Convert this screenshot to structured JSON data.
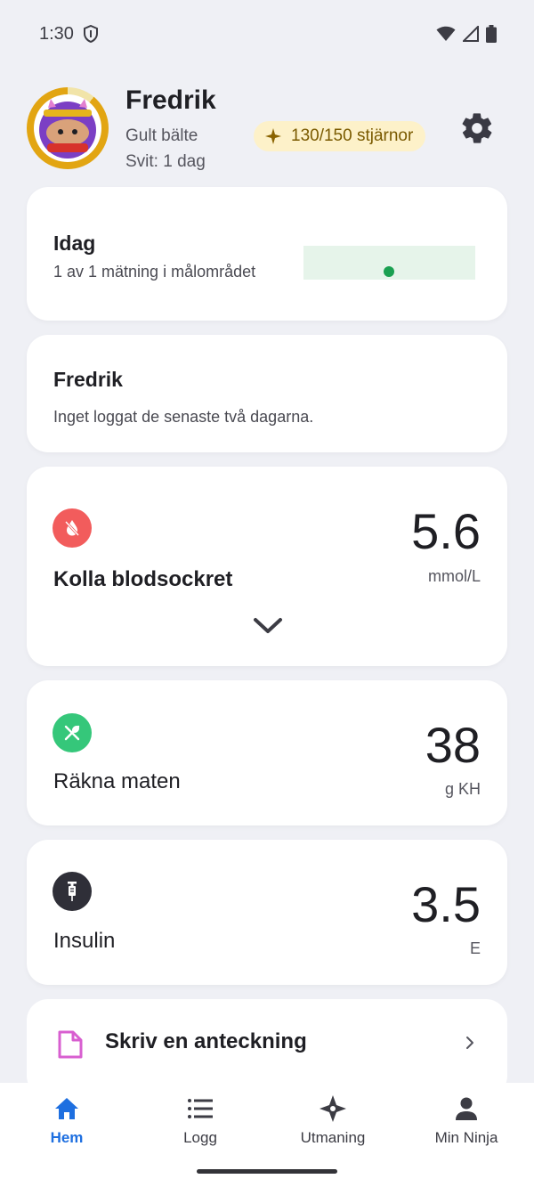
{
  "status_bar": {
    "time": "1:30"
  },
  "profile": {
    "name": "Fredrik",
    "belt": "Gult bälte",
    "streak": "Svit: 1 dag",
    "stars": "130/150 stjärnor"
  },
  "today_card": {
    "title": "Idag",
    "subtitle": "1 av 1 mätning i målområdet"
  },
  "log_card": {
    "title": "Fredrik",
    "message": "Inget loggat de senaste två dagarna."
  },
  "blood_sugar": {
    "label": "Kolla blodsockret",
    "value": "5.6",
    "unit": "mmol/L",
    "color": "#f25c5c"
  },
  "food": {
    "label": "Räkna maten",
    "value": "38",
    "unit": "g KH",
    "color": "#35c77a"
  },
  "insulin": {
    "label": "Insulin",
    "value": "3.5",
    "unit": "E",
    "color": "#2f2f38"
  },
  "note": {
    "label": "Skriv en anteckning",
    "color": "#d85fd0"
  },
  "nav": {
    "items": [
      {
        "label": "Hem"
      },
      {
        "label": "Logg"
      },
      {
        "label": "Utmaning"
      },
      {
        "label": "Min Ninja"
      }
    ],
    "active_color": "#1e6fe0"
  }
}
